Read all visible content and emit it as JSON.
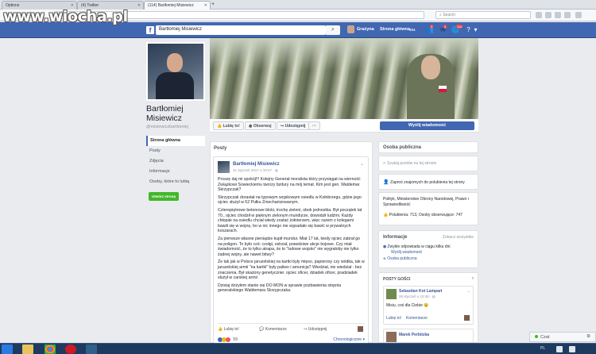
{
  "watermark": "www.wiocha.pl",
  "browser": {
    "tabs": [
      {
        "label": "Options"
      },
      {
        "label": "(4) Twitter"
      },
      {
        "label": "(114) Bartłomiej Misiewicz"
      }
    ],
    "search_placeholder": "Search"
  },
  "fb": {
    "search_value": "Bartłomiej Misiewicz",
    "nav_user": "Grażyna",
    "nav_home": "Strona główna",
    "nav_home_count": "294",
    "badge_friends": "3",
    "badge_messages": "4",
    "badge_notif": "114"
  },
  "profile": {
    "name_line1": "Bartłomiej",
    "name_line2": "Misiewicz",
    "handle": "@misiewiczbartlomiej",
    "nav": [
      "Strona główna",
      "Posty",
      "Zdjęcia",
      "Informacje",
      "Osoby, które to lubią"
    ],
    "create_page": "Utwórz stronę"
  },
  "actions": {
    "like": "Lubię to!",
    "follow": "Obserwuj",
    "share": "Udostępnij",
    "more": "···",
    "message": "Wyślij wiadomość"
  },
  "posts_header": "Posty",
  "post": {
    "author": "Bartłomiej Misiewicz",
    "date": "31 styczeń 2017 o 19:47 · ",
    "paragraphs": [
      "Proszę daj mi spokój!!! Kolejny Generał moralista który przysięgał na wierność Związkowi Sowieckiemu tworzy bzdury na mój temat. Kim jest gen. Waldemar Skrzypczak?",
      "Skrzypczak dorastał na typowym wojskowym osiedlu w Kołobrzegu, gdzie jego ojciec służył w 52 Pułku Zmechanizowanym.",
      "Czteropiętrowe betonowe bloki, trochę zieleni, obok jednostka. Był początek lat 70., ojciec chodził w pięknym zielonym mundurze, dowodził ludźmi. Każdy chłopak na osiedlu chciał wtedy zostać żołnierzem, więc razem z kolegami bawili się w wojnę, bo w nic innego nie wypadało się bawić w prywatnych koszarach.",
      "Za pierwsze własne pieniądze kupił mundur. Miał 17 lat, kiedy ojciec zabrał go na poligon. To było coś: czołgi, ostrzał, prawdziwe akcje bojowe. Czy miał świadomość, że to tylko atrapa, że to \"ludowe wojsko\" nie wygrałoby nie tylko żadnej wojny, ale nawet bitwy?",
      "Że tak jak w Polsce jaruzelskiej na kartki były mięso, papierosy czy wódka, tak w jaruzelskiej armii \"na kartki\" były paliwo i amunicja? Wiedział, nie wiedział - bez znaczenia. Był skażony genetycznie: ojciec oficer, dziadek oficer, pradziadek służył w carskiej armii",
      "Dzisiaj dożyłem stanie się DO MON w sprawie pozbawienia stopnia generalskiego Waldemara Skrzypczaka."
    ],
    "like": "Lubię to!",
    "comment": "Komentarze",
    "share": "Udostępnij",
    "reactions_count": "59",
    "order": "Chronologicznie"
  },
  "sidebar": {
    "category_header": "Osoba publiczna",
    "search_placeholder": "Szukaj postów na tej stronie",
    "invite": "Zaproś znajomych do polubienia tej strony",
    "category_text": "Polityk, Ministerstwo Obrony Narodowej, Prawo i Sprawiedliwość",
    "likes_text": "Polubienia: 713, Osoby obserwujące: 747",
    "info_header": "Informacje",
    "info_link": "Zobacz wszystkie",
    "response": "Zwykle odpowiada w ciągu kilku dni",
    "send_message": "Wyślij wiadomość",
    "public_figure": "Osoba publiczna",
    "guests_header": "POSTY GOŚCI",
    "guest_name": "Sebastian Kot Lampart",
    "guest_date": "26 styczeń o 12:46 · ",
    "guest_text": "Misiu, coś dla Ciebie 😉",
    "guest_like": "Lubię to!",
    "guest_comment": "Komentarze",
    "guest2_name": "Marek Perbitzka"
  },
  "chat": {
    "label": "Czat"
  }
}
